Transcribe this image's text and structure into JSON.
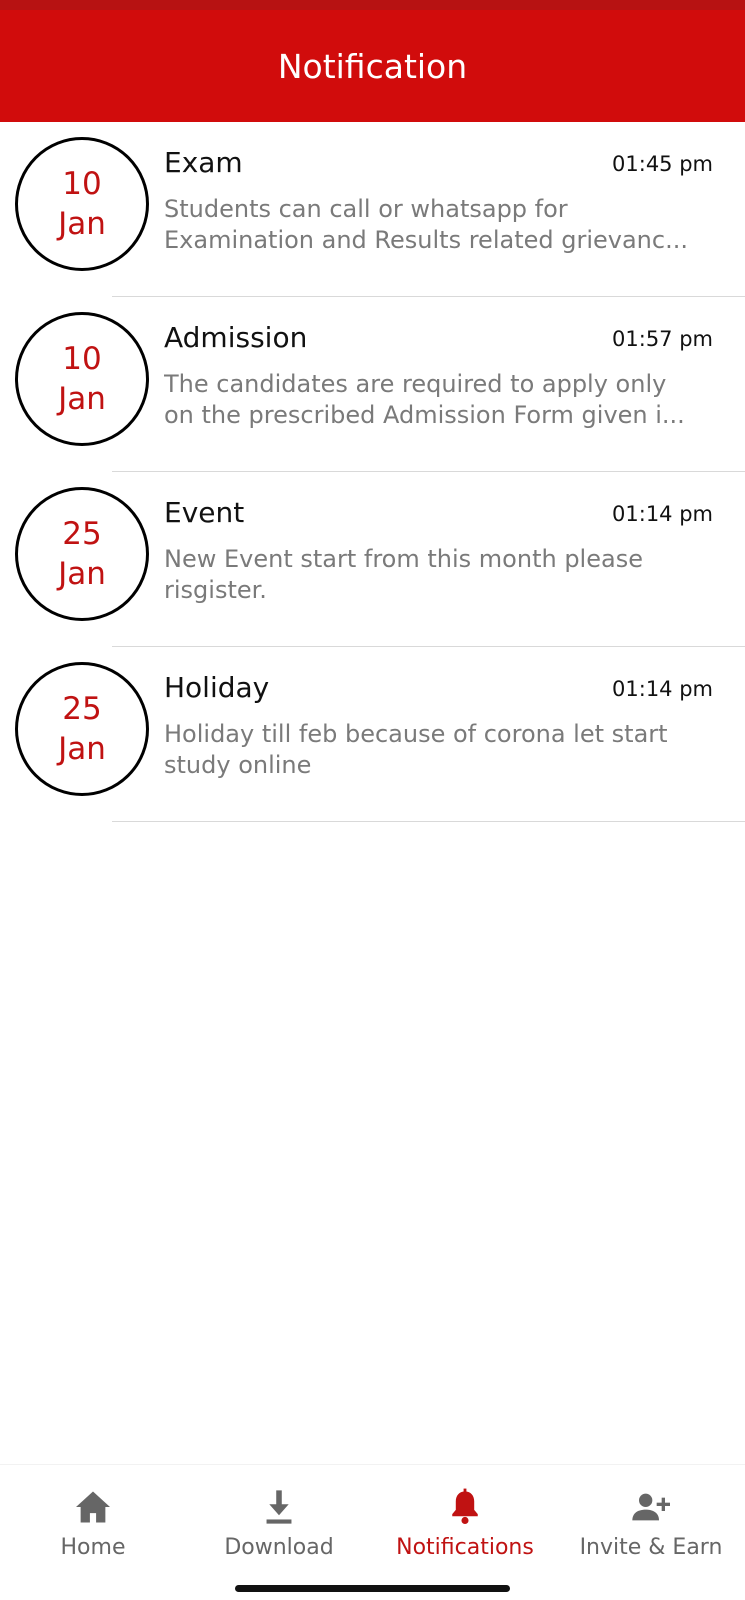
{
  "header": {
    "title": "Notification"
  },
  "notifications": [
    {
      "day": "10",
      "month": "Jan",
      "title": "Exam",
      "time": "01:45 pm",
      "desc_line1": "Students can call or whatsapp for",
      "desc_line2": "Examination and Results related grievanc..."
    },
    {
      "day": "10",
      "month": "Jan",
      "title": "Admission",
      "time": "01:57 pm",
      "desc_line1": "The candidates are required to apply only",
      "desc_line2": "on the prescribed Admission Form given i..."
    },
    {
      "day": "25",
      "month": "Jan",
      "title": "Event",
      "time": "01:14 pm",
      "desc_line1": "New Event start from this month please",
      "desc_line2": "risgister."
    },
    {
      "day": "25",
      "month": "Jan",
      "title": "Holiday",
      "time": "01:14 pm",
      "desc_line1": "Holiday till feb because of corona let start",
      "desc_line2": "study online"
    }
  ],
  "bottom_nav": {
    "items": [
      {
        "label": "Home",
        "icon": "home-icon"
      },
      {
        "label": "Download",
        "icon": "download-icon"
      },
      {
        "label": "Notifications",
        "icon": "bell-icon",
        "active": true
      },
      {
        "label": "Invite & Earn",
        "icon": "add-person-icon"
      }
    ]
  },
  "colors": {
    "primary": "#d10c0c",
    "accent": "#c01212",
    "inactive": "#666666"
  }
}
